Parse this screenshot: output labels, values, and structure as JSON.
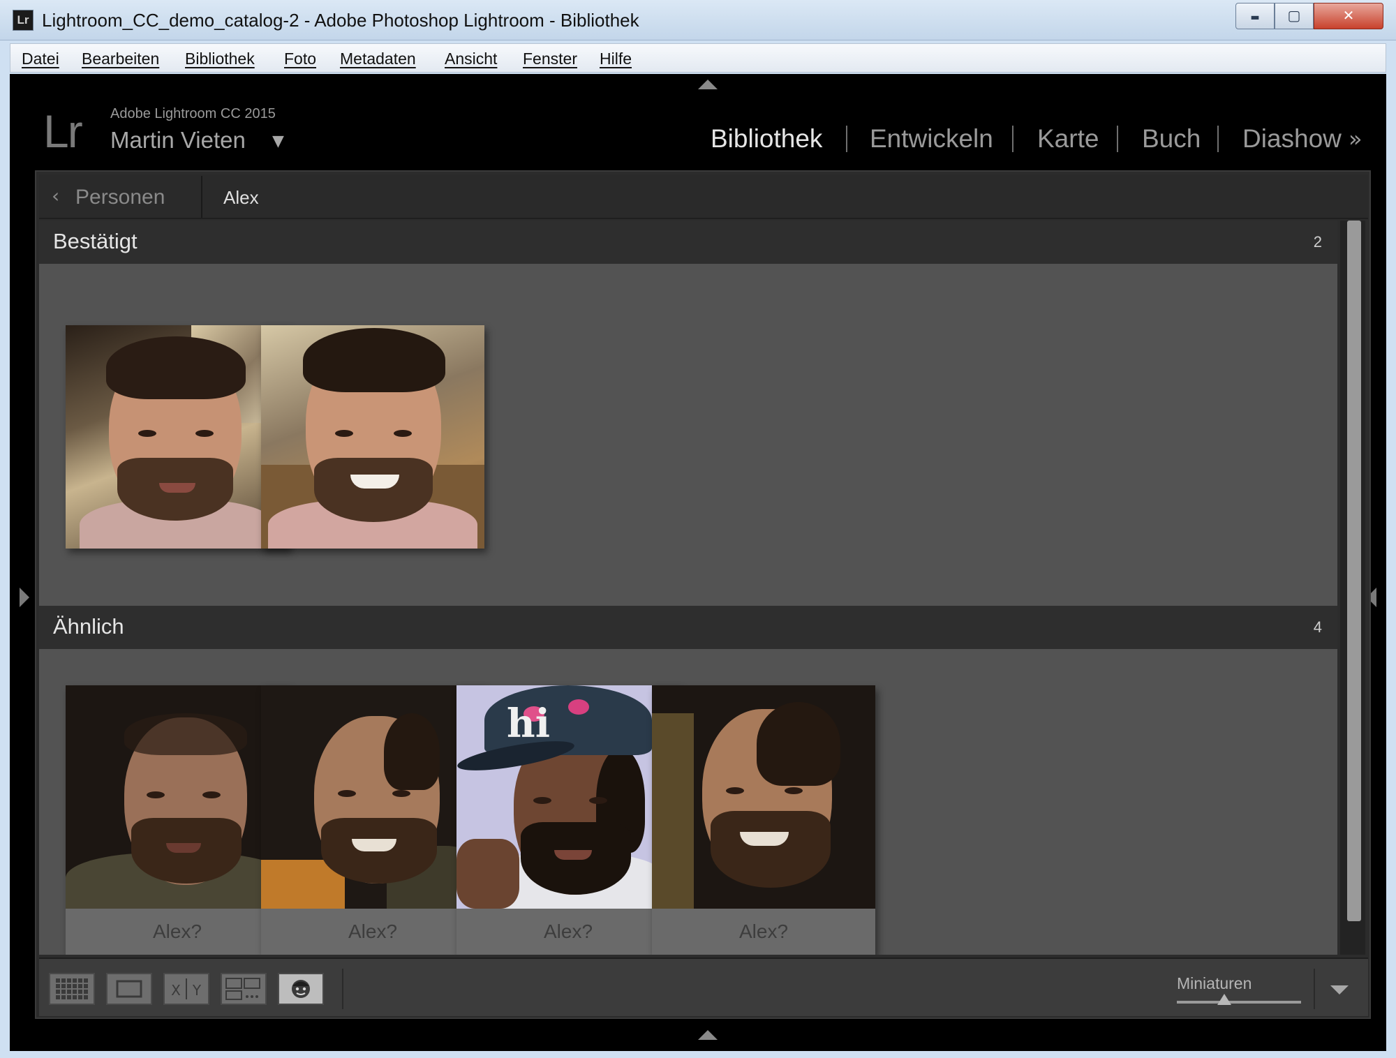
{
  "window": {
    "title": "Lightroom_CC_demo_catalog-2 - Adobe Photoshop Lightroom - Bibliothek",
    "app_icon": "Lr",
    "minimize_glyph": "▬",
    "maximize_glyph": "▢",
    "close_glyph": "✕"
  },
  "menubar": {
    "items": [
      "Datei",
      "Bearbeiten",
      "Bibliothek",
      "Foto",
      "Metadaten",
      "Ansicht",
      "Fenster",
      "Hilfe"
    ]
  },
  "identity": {
    "logo": "Lr",
    "product": "Adobe Lightroom CC 2015",
    "user": "Martin Vieten",
    "caret": "▼"
  },
  "modules": {
    "items": [
      "Bibliothek",
      "Entwickeln",
      "Karte",
      "Buch",
      "Diashow"
    ],
    "active": "Bibliothek",
    "more": "»"
  },
  "breadcrumb": {
    "back_label": "Personen",
    "back_icon": "chevron-left-icon",
    "current": "Alex"
  },
  "sections": {
    "confirmed": {
      "title": "Bestätigt",
      "count": "2"
    },
    "similar": {
      "title": "Ähnlich",
      "count": "4"
    }
  },
  "similar_labels": [
    "Alex?",
    "Alex?",
    "Alex?",
    "Alex?"
  ],
  "toolbar": {
    "buttons": [
      "grid-view-icon",
      "loupe-view-icon",
      "compare-view-icon",
      "survey-view-icon",
      "people-view-icon"
    ],
    "compare_text": "X|Y",
    "thumbnail_label": "Miniaturen",
    "thumbnail_size": 0.38
  },
  "colors": {
    "app_bg": "#000000",
    "content_bg": "#535353",
    "section_header_bg": "#2e2e2e",
    "active_module": "#e6e6e6",
    "inactive_module": "#9a9a9a"
  }
}
